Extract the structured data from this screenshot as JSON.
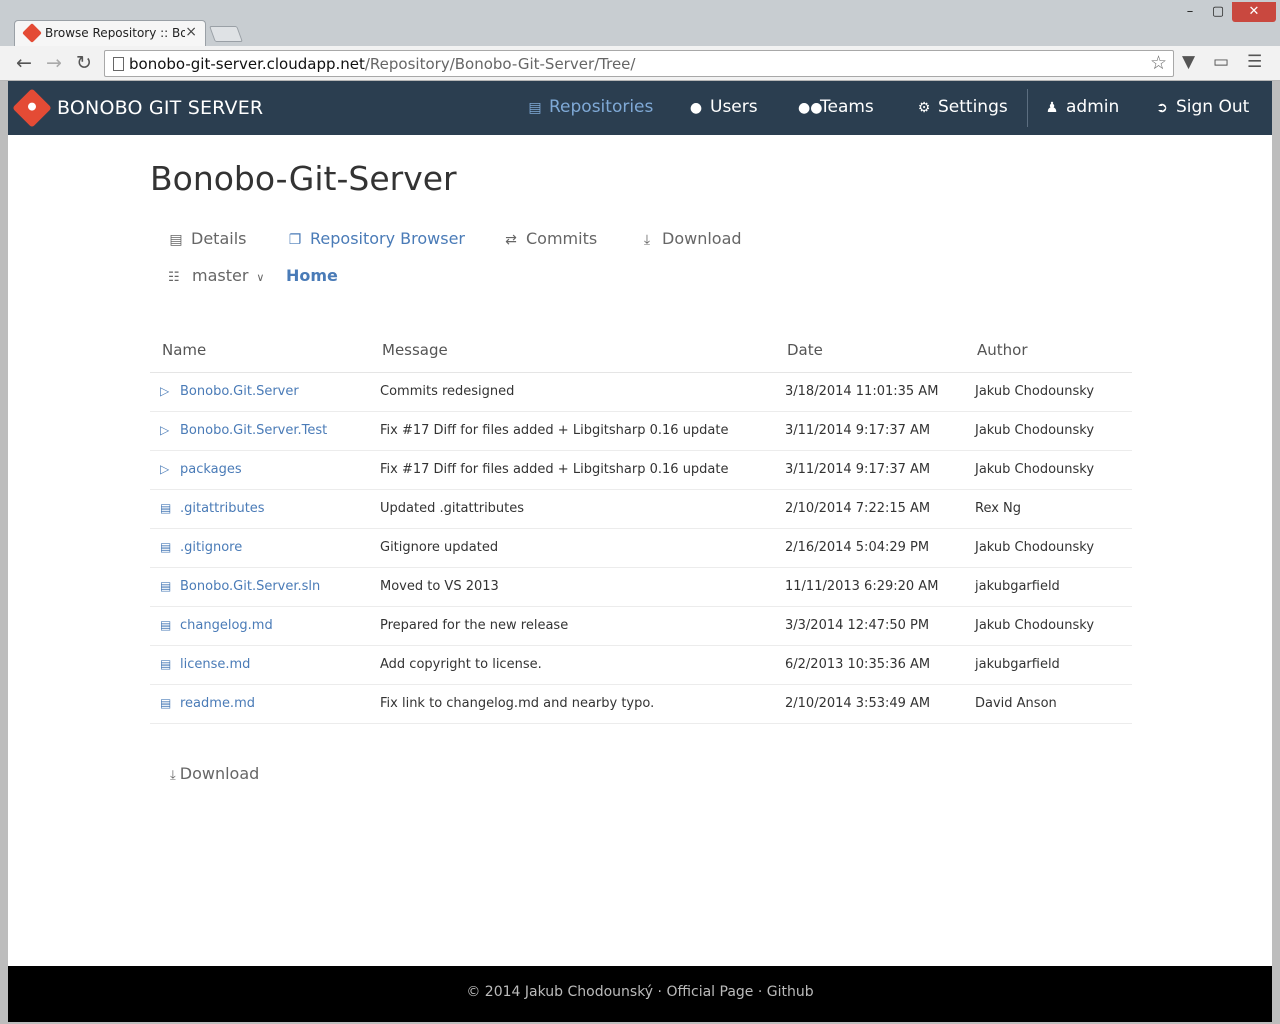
{
  "browser": {
    "tab_title": "Browse Repository :: Bonobo",
    "url_host": "bonobo-git-server.cloudapp.net",
    "url_path": "/Repository/Bonobo-Git-Server/Tree/",
    "tab_close": "×"
  },
  "app": {
    "brand": "BONOBO GIT SERVER",
    "nav": [
      {
        "label": "Repositories",
        "icon": "repository-icon"
      },
      {
        "label": "Users",
        "icon": "user-icon"
      },
      {
        "label": "Teams",
        "icon": "team-icon"
      },
      {
        "label": "Settings",
        "icon": "gears-icon"
      },
      {
        "label": "admin",
        "icon": "person-icon"
      },
      {
        "label": "Sign Out",
        "icon": "sign-out-icon"
      }
    ],
    "accent_color": "#7fa9d6",
    "link_color": "#4a7bb7",
    "nav_bg": "#2b3e50"
  },
  "repo": {
    "title": "Bonobo-Git-Server",
    "tabs": [
      {
        "label": "Details",
        "icon": "hdd-icon"
      },
      {
        "label": "Repository Browser",
        "icon": "copy-icon"
      },
      {
        "label": "Commits",
        "icon": "shuffle-icon"
      },
      {
        "label": "Download",
        "icon": "download-icon"
      }
    ],
    "branch": "master",
    "breadcrumb_home": "Home"
  },
  "table": {
    "headers": [
      "Name",
      "Message",
      "Date",
      "Author"
    ],
    "rows": [
      {
        "type": "folder",
        "name": "Bonobo.Git.Server",
        "message": "Commits redesigned",
        "date": "3/18/2014 11:01:35 AM",
        "author": "Jakub Chodounsky"
      },
      {
        "type": "folder",
        "name": "Bonobo.Git.Server.Test",
        "message": "Fix #17 Diff for files added + Libgitsharp 0.16 update",
        "date": "3/11/2014 9:17:37 AM",
        "author": "Jakub Chodounsky"
      },
      {
        "type": "folder",
        "name": "packages",
        "message": "Fix #17 Diff for files added + Libgitsharp 0.16 update",
        "date": "3/11/2014 9:17:37 AM",
        "author": "Jakub Chodounsky"
      },
      {
        "type": "file",
        "name": ".gitattributes",
        "message": "Updated .gitattributes",
        "date": "2/10/2014 7:22:15 AM",
        "author": "Rex Ng"
      },
      {
        "type": "file",
        "name": ".gitignore",
        "message": "Gitignore updated",
        "date": "2/16/2014 5:04:29 PM",
        "author": "Jakub Chodounsky"
      },
      {
        "type": "file",
        "name": "Bonobo.Git.Server.sln",
        "message": "Moved to VS 2013",
        "date": "11/11/2013 6:29:20 AM",
        "author": "jakubgarfield"
      },
      {
        "type": "file",
        "name": "changelog.md",
        "message": "Prepared for the new release",
        "date": "3/3/2014 12:47:50 PM",
        "author": "Jakub Chodounsky"
      },
      {
        "type": "file",
        "name": "license.md",
        "message": "Add copyright to license.",
        "date": "6/2/2013 10:35:36 AM",
        "author": "jakubgarfield"
      },
      {
        "type": "file",
        "name": "readme.md",
        "message": "Fix link to changelog.md and nearby typo.",
        "date": "2/10/2014 3:53:49 AM",
        "author": "David Anson"
      }
    ]
  },
  "bottom": {
    "download_label": "Download"
  },
  "footer": {
    "copyright": "© 2014 Jakub Chodounský",
    "sep": "·",
    "official_page": "Official Page",
    "github": "Github"
  }
}
